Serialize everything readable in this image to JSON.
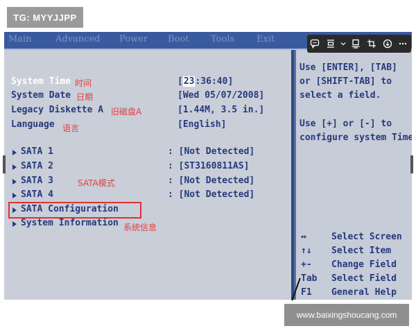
{
  "watermark_top": "TG: MYYJJPP",
  "watermark_bottom": "www.baixingshoucang.com",
  "menu": [
    "Main",
    "Advanced",
    "Power",
    "Boot",
    "Tools",
    "Exit"
  ],
  "rows": [
    {
      "label": "System Time",
      "value_cursor": "23",
      "value_rest": ":36:40]",
      "annotation": "时间"
    },
    {
      "label": "System Date",
      "value": "[Wed 05/07/2008]",
      "annotation": "日期"
    },
    {
      "label": "Legacy Diskette A",
      "value": "[1.44M, 3.5 in.]",
      "annotation": "旧磁盘A"
    },
    {
      "label": "Language",
      "value": "[English]",
      "annotation": "语言"
    }
  ],
  "sata": [
    {
      "label": "SATA 1",
      "value": ": [Not Detected]"
    },
    {
      "label": "SATA 2",
      "value": ": [ST3160811AS]"
    },
    {
      "label": "SATA 3",
      "value": ": [Not Detected]"
    },
    {
      "label": "SATA 4",
      "value": ": [Not Detected]"
    }
  ],
  "sata_mode_annotation": "SATA模式",
  "sata_configuration": "SATA Configuration",
  "system_information": "System Information",
  "system_information_annotation": "系统信息",
  "help": [
    "Use [ENTER], [TAB]",
    "or [SHIFT-TAB] to",
    "select a field.",
    "Use [+] or [-] to",
    "configure system Time"
  ],
  "keys": [
    {
      "key": "↔",
      "desc": "Select Screen"
    },
    {
      "key": "↑↓",
      "desc": "Select Item"
    },
    {
      "key": "+-",
      "desc": "Change Field"
    },
    {
      "key": "Tab",
      "desc": "Select Field"
    },
    {
      "key": "F1",
      "desc": "General Help"
    }
  ],
  "toolbar_icons": [
    "comment-icon",
    "frame-icon",
    "chevron-down-icon",
    "ocr-icon",
    "crop-icon",
    "download-icon",
    "more-icon"
  ]
}
